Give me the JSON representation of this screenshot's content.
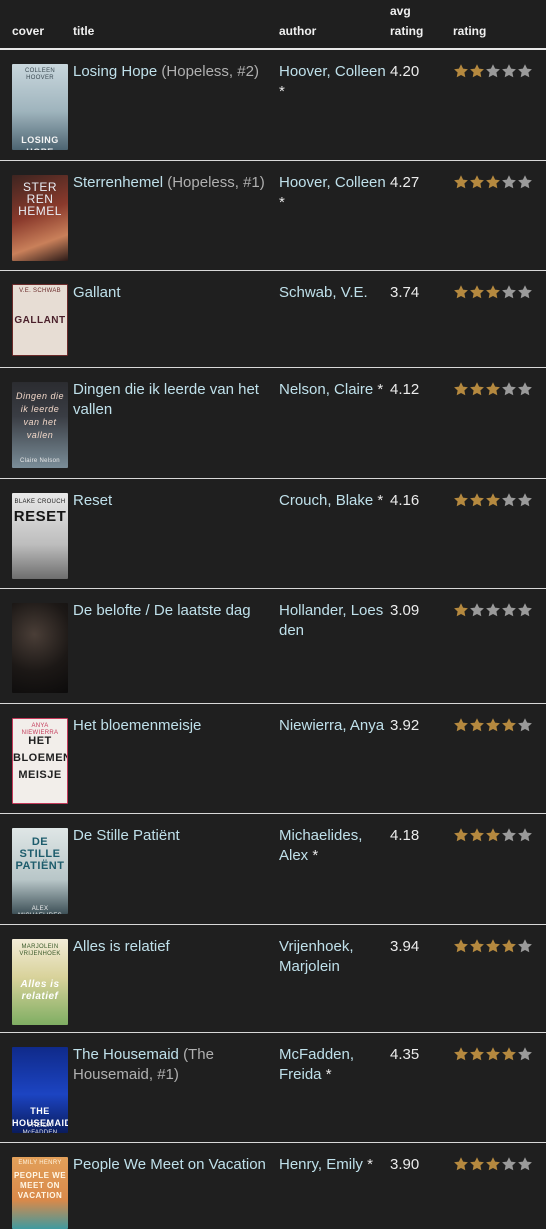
{
  "columns": {
    "cover": "cover",
    "title": "title",
    "author": "author",
    "avg_top": "avg",
    "avg_bottom": "rating",
    "rating": "rating"
  },
  "colors": {
    "background": "#1f1f1f",
    "link": "#bfe0ea",
    "star_filled": "#b5893f",
    "star_empty": "#9a9a9a"
  },
  "books": [
    {
      "title": "Losing Hope",
      "series": "(Hopeless, #2)",
      "author": "Hoover, Colleen",
      "author_star": "*",
      "avg": "4.20",
      "rating": 2,
      "cover_text": "LOSING HOPE",
      "cover_author": "COLLEEN HOOVER"
    },
    {
      "title": "Sterrenhemel",
      "series": "(Hopeless, #1)",
      "author": "Hoover, Colleen",
      "author_star": "*",
      "avg": "4.27",
      "rating": 3,
      "cover_text": "STER REN HEMEL",
      "cover_author": ""
    },
    {
      "title": "Gallant",
      "series": "",
      "author": "Schwab, V.E.",
      "author_star": "",
      "avg": "3.74",
      "rating": 3,
      "cover_text": "GALLANT",
      "cover_author": "V.E. SCHWAB"
    },
    {
      "title": "Dingen die ik leerde van het vallen",
      "series": "",
      "author": "Nelson, Claire",
      "author_star": "*",
      "avg": "4.12",
      "rating": 3,
      "cover_text": "Dingen die ik leerde van het vallen",
      "cover_author": "Claire Nelson"
    },
    {
      "title": "Reset",
      "series": "",
      "author": "Crouch, Blake",
      "author_star": "*",
      "avg": "4.16",
      "rating": 3,
      "cover_text": "RESET",
      "cover_author": "BLAKE CROUCH"
    },
    {
      "title": "De belofte / De laatste dag",
      "series": "",
      "author": "Hollander, Loes den",
      "author_star": "",
      "avg": "3.09",
      "rating": 1,
      "cover_text": "",
      "cover_author": ""
    },
    {
      "title": "Het bloemenmeisje",
      "series": "",
      "author": "Niewierra, Anya",
      "author_star": "",
      "avg": "3.92",
      "rating": 4,
      "cover_text": "HET BLOEMEN MEISJE",
      "cover_author": "ANYA NIEWIERRA"
    },
    {
      "title": "De Stille Patiënt",
      "series": "",
      "author": "Michaelides, Alex",
      "author_star": "*",
      "avg": "4.18",
      "rating": 3,
      "cover_text": "DE STILLE PATIËNT",
      "cover_author": "ALEX MICHAELIDES"
    },
    {
      "title": "Alles is relatief",
      "series": "",
      "author": "Vrijenhoek, Marjolein",
      "author_star": "",
      "avg": "3.94",
      "rating": 4,
      "cover_text": "Alles is relatief",
      "cover_author": "MARJOLEIN VRIJENHOEK"
    },
    {
      "title": "The Housemaid",
      "series": "(The Housemaid, #1)",
      "author": "McFadden, Freida",
      "author_star": "*",
      "avg": "4.35",
      "rating": 4,
      "cover_text": "THE HOUSEMAID",
      "cover_author": "FREIDA McFADDEN"
    },
    {
      "title": "People We Meet on Vacation",
      "series": "",
      "author": "Henry, Emily",
      "author_star": "*",
      "avg": "3.90",
      "rating": 3,
      "cover_text": "PEOPLE WE MEET ON VACATION",
      "cover_author": "EMILY HENRY"
    }
  ]
}
